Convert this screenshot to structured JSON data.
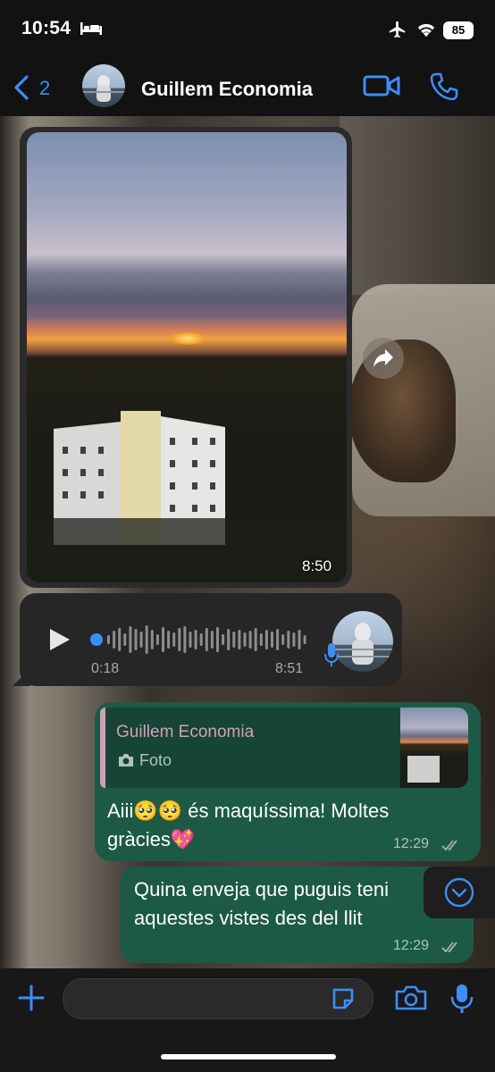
{
  "status_bar": {
    "time": "10:54",
    "battery": "85"
  },
  "header": {
    "back_count": "2",
    "contact_name": "Guillem Economia"
  },
  "messages": {
    "photo": {
      "time": "8:50"
    },
    "voice": {
      "duration": "0:18",
      "time": "8:51"
    },
    "reply": {
      "quote_author": "Guillem Economia",
      "quote_type": "Foto",
      "text": "Aiii🥺🥺 és maquíssima! Moltes gràcies💖",
      "time": "12:29"
    },
    "text2": {
      "text": "Quina enveja que puguis teni aquestes vistes des del llit",
      "time": "12:29"
    }
  },
  "colors": {
    "accent": "#3c8ef8",
    "outgoing_bubble": "#1d5a46",
    "incoming_bubble": "#262626",
    "quote_name": "#d99dbb"
  },
  "icons": [
    "bed-icon",
    "airplane-icon",
    "wifi-icon",
    "back-chevron-icon",
    "video-icon",
    "phone-icon",
    "forward-icon",
    "play-icon",
    "mic-icon",
    "camera-icon",
    "double-check-icon",
    "chevron-down-icon",
    "plus-icon",
    "sticker-icon"
  ]
}
